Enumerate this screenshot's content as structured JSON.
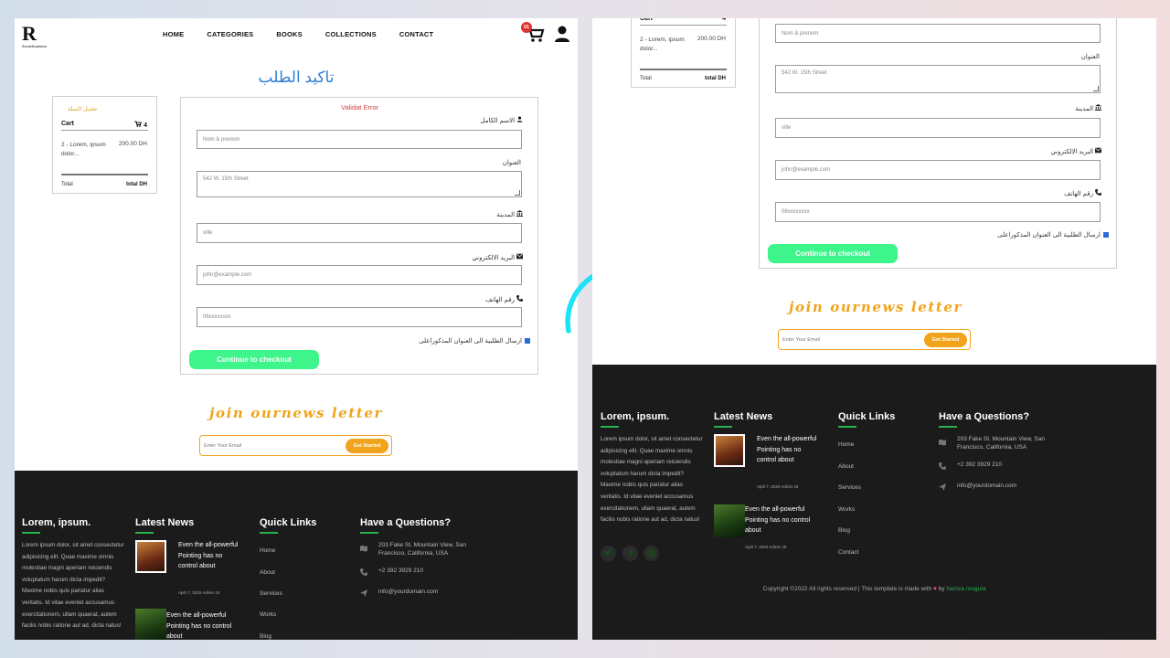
{
  "nav": {
    "logo_text": "R",
    "logo_sub": "RomanBookstore",
    "menu": [
      "HOME",
      "CATEGORIES",
      "BOOKS",
      "COLLECTIONS",
      "CONTACT"
    ],
    "cart_badge": "01",
    "icons": [
      "cart-icon",
      "user-icon"
    ]
  },
  "page_title": "تاكيد الطلب",
  "cart": {
    "edit_label": "تعديل السلة",
    "title": "Cart",
    "count": "4",
    "item_text": "2 - Lorem, ipsum dolor...",
    "item_price": "200.00 DH",
    "total_label": "Total",
    "total_value": "total DH"
  },
  "form": {
    "error": "Validat Error",
    "name_label": "الاسم الكامل",
    "name_placeholder": "Nom & prenom",
    "address_label": "العنوان",
    "address_value": "542 W. 15th Street",
    "city_label": "المدينة",
    "city_placeholder": "ville",
    "email_label": "البريد الالكتروني",
    "email_placeholder": "john@example.com",
    "phone_label": "رقم الهاتف",
    "phone_placeholder": "06xxxxxxxx",
    "checkbox_label": "ارسال الطلبية الى العنوان المذكوراعلى",
    "checkbox_checked": true,
    "submit_label": "Continue to checkout"
  },
  "newsletter": {
    "title": "join ournews letter",
    "placeholder": "Enter Your Email",
    "button": "Get Started"
  },
  "footer": {
    "about_title": "Lorem, ipsum.",
    "about_text": "Lorem ipsum dolor, sit amet consectetur adipisicing elit. Quae maxime omnis molestiae magni aperiam reiciendis voluptatum harum dicta impedit? Maxime nobis quis pariatur alias veritatis. Id vitae eveniet accusamus exercitationem, ullam quaerat, autem facilis nobis ratione aut ad, dicta natus!",
    "news_title": "Latest News",
    "news": [
      {
        "title": "Even the all-powerful Pointing has no control about",
        "meta": "April 7, 2020   Admin   19"
      },
      {
        "title": "Even the all-powerful Pointing has no control about",
        "meta": "April 7, 2020   Admin   19"
      }
    ],
    "links_title": "Quick Links",
    "links": [
      "Home",
      "About",
      "Services",
      "Works",
      "Blog",
      "Contact"
    ],
    "contact_title": "Have a Questions?",
    "address": "203 Fake St. Mountain View, San Francisco, California, USA",
    "phone": "+2 392 3929 210",
    "email": "info@yourdomain.com",
    "copyright": "Copyright ©2022 All rights reserved | This template is made with",
    "copyright_by": "by",
    "copyright_author": "hamza rouguia",
    "accent_color": "#28b04c"
  }
}
